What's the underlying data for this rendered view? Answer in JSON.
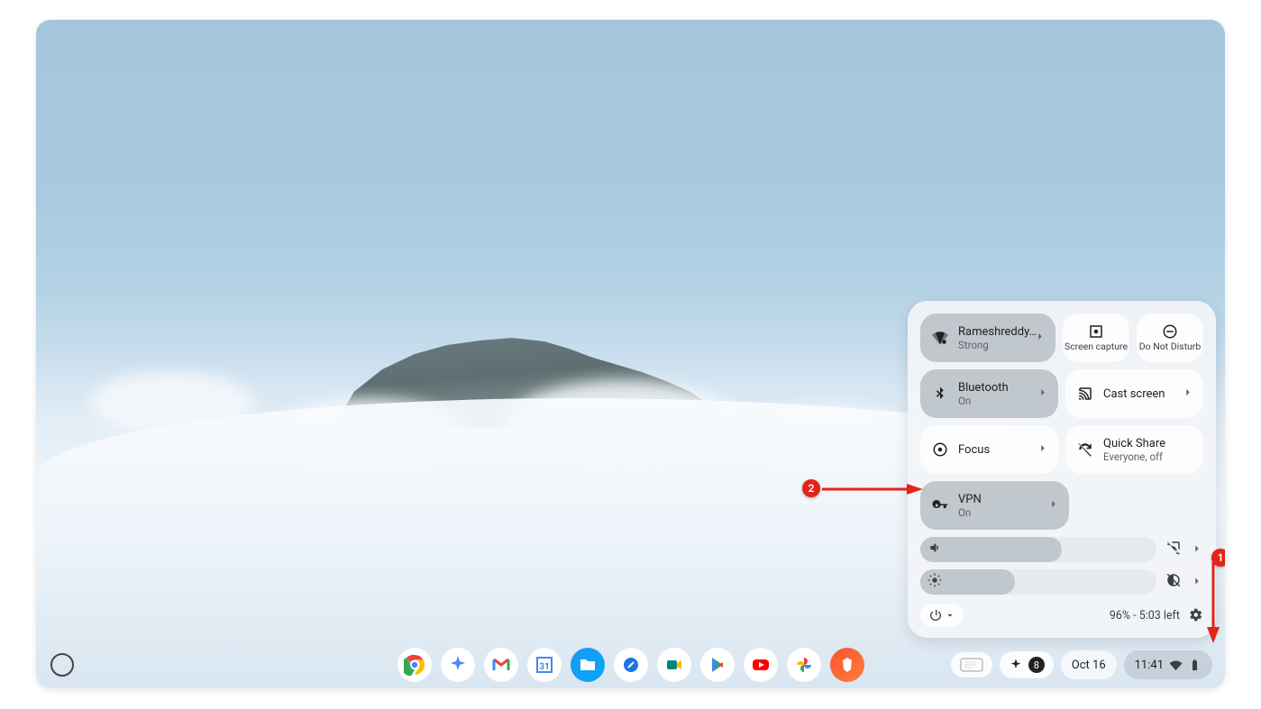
{
  "shelf": {
    "date": "Oct 16",
    "time": "11:41",
    "notif_count": "8",
    "apps": [
      "chrome",
      "gemini",
      "gmail",
      "calendar",
      "files",
      "chat",
      "meet",
      "play",
      "youtube",
      "photos",
      "brave"
    ]
  },
  "qs": {
    "wifi": {
      "title": "Rameshreddy…",
      "sub": "Strong"
    },
    "screencap": {
      "title": "Screen capture"
    },
    "dnd": {
      "title": "Do Not Disturb"
    },
    "bluetooth": {
      "title": "Bluetooth",
      "sub": "On"
    },
    "cast": {
      "title": "Cast screen"
    },
    "focus": {
      "title": "Focus"
    },
    "quickshare": {
      "title": "Quick Share",
      "sub": "Everyone, off"
    },
    "vpn": {
      "title": "VPN",
      "sub": "On"
    },
    "battery": "96% - 5:03 left",
    "volume_pct": 60,
    "brightness_pct": 40
  },
  "annotations": {
    "badge1": "1",
    "badge2": "2"
  }
}
